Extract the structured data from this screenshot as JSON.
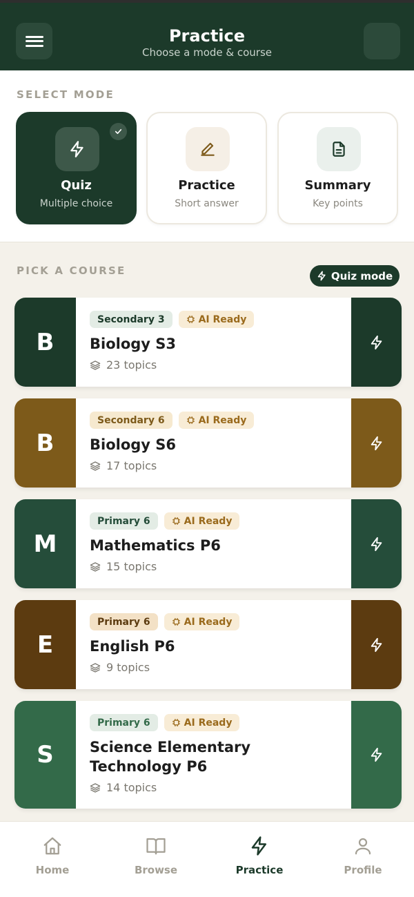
{
  "header": {
    "title": "Practice",
    "subtitle": "Choose a mode & course",
    "menu_icon": "menu-icon"
  },
  "mode_section": {
    "label": "SELECT MODE",
    "modes": [
      {
        "title": "Quiz",
        "subtitle": "Multiple choice",
        "icon": "lightning-icon",
        "selected": true
      },
      {
        "title": "Practice",
        "subtitle": "Short answer",
        "icon": "pencil-icon",
        "selected": false
      },
      {
        "title": "Summary",
        "subtitle": "Key points",
        "icon": "document-icon",
        "selected": false
      }
    ]
  },
  "course_section": {
    "label": "PICK A COURSE",
    "mode_chip": "Quiz mode",
    "courses": [
      {
        "letter": "B",
        "level": "Secondary 3",
        "ai_tag": "AI Ready",
        "name": "Biology S3",
        "topics": "23 topics",
        "color": "#1c3a2a",
        "level_bg": "#e3ece5",
        "level_fg": "#1c3a2a"
      },
      {
        "letter": "B",
        "level": "Secondary 6",
        "ai_tag": "AI Ready",
        "name": "Biology S6",
        "topics": "17 topics",
        "color": "#7d5a1a",
        "level_bg": "#f6e9cf",
        "level_fg": "#7d5a1a"
      },
      {
        "letter": "M",
        "level": "Primary 6",
        "ai_tag": "AI Ready",
        "name": "Mathematics P6",
        "topics": "15 topics",
        "color": "#254d3a",
        "level_bg": "#e3ece5",
        "level_fg": "#254d3a"
      },
      {
        "letter": "E",
        "level": "Primary 6",
        "ai_tag": "AI Ready",
        "name": "English P6",
        "topics": "9 topics",
        "color": "#5c3b10",
        "level_bg": "#f3e1c6",
        "level_fg": "#5c3b10"
      },
      {
        "letter": "S",
        "level": "Primary 6",
        "ai_tag": "AI Ready",
        "name": "Science Elementary Technology P6",
        "topics": "14 topics",
        "color": "#336a49",
        "level_bg": "#e3ece5",
        "level_fg": "#336a49"
      }
    ]
  },
  "bottom_nav": {
    "items": [
      {
        "label": "Home",
        "icon": "home-icon",
        "active": false
      },
      {
        "label": "Browse",
        "icon": "book-icon",
        "active": false
      },
      {
        "label": "Practice",
        "icon": "lightning-icon",
        "active": true
      },
      {
        "label": "Profile",
        "icon": "person-icon",
        "active": false
      }
    ]
  },
  "colors": {
    "brand_dark_green": "#1c3a2a",
    "background": "#f4f1ea",
    "muted_label": "#a39f94"
  }
}
